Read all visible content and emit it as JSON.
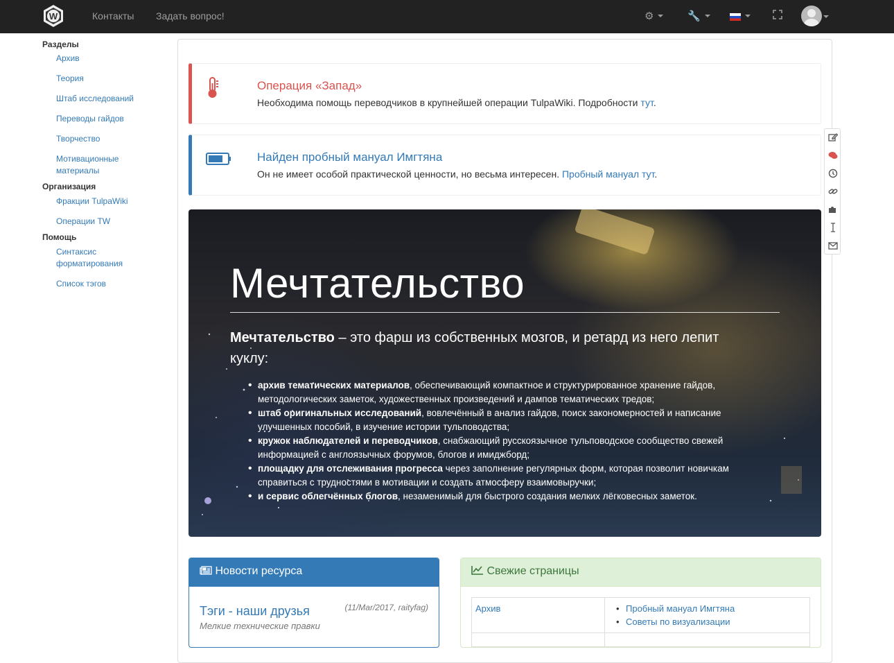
{
  "nav": {
    "links": [
      "Контакты",
      "Задать вопрос!"
    ]
  },
  "sidebar": {
    "sections": [
      {
        "title": "Разделы",
        "items": [
          "Архив",
          "Теория",
          "Штаб исследований",
          "Переводы гайдов",
          "Творчество",
          "Мотивационные материалы"
        ]
      },
      {
        "title": "Организация",
        "items": [
          "Фракции TulpaWiki",
          "Операции TW"
        ]
      },
      {
        "title": "Помощь",
        "items": [
          "Синтаксис форматирования",
          "Список тэгов"
        ]
      }
    ]
  },
  "alerts": [
    {
      "title": "Операция «Запад»",
      "text": "Необходима помощь переводчиков в крупнейшей операции TulpaWiki. Подробности ",
      "link": "тут",
      "tail": ".",
      "color": "#d9534f"
    },
    {
      "title": "Найден пробный мануал Имгтяна",
      "text": "Он не имеет особой практической ценности, но весьма интересен. ",
      "link": "Пробный мануал тут",
      "tail": ".",
      "color": "#337ab7"
    }
  ],
  "hero": {
    "title": "Мечтательство",
    "lead_bold": "Мечтательство",
    "lead_rest": " – это фарш из собственных мозгов, и ретард из него лепит куклу:",
    "items": [
      {
        "bold": "архив тематических материалов",
        "rest": ", обеспечивающий компактное и структурированное хранение гайдов, методологических заметок, художественных произведений и дампов тематических тредов;"
      },
      {
        "bold": "штаб оригинальных исследований",
        "rest": ", вовлечённый в анализ гайдов, поиск закономерностей и написание улучшенных пособий, в изучение истории тульповодства;"
      },
      {
        "bold": "кружок наблюдателей и переводчиков",
        "rest": ", снабжающий русскоязычное тульповодское сообщество свежей информацией с англоязычных форумов, блогов и имиджборд;"
      },
      {
        "bold": "площадку для отслеживания прогресса",
        "rest": " через заполнение регулярных форм, которая позволит новичкам справиться с трудностями в мотивации и создать атмосферу взаимовыручки;"
      },
      {
        "bold": "и сервис облегчённых блогов",
        "rest": ", незаменимый для быстрого создания мелких лёгковесных заметок."
      }
    ]
  },
  "news": {
    "header": "Новости ресурса",
    "item_title": "Тэги - наши друзья",
    "item_meta": "(11/Mar/2017, raityfag)",
    "item_desc": "Мелкие технические правки"
  },
  "fresh": {
    "header": "Свежие страницы",
    "rows": [
      {
        "section": "Архив",
        "pages": [
          "Пробный мануал Имгтяна",
          "Советы по визуализации"
        ]
      }
    ]
  },
  "colors": {
    "navbar": "#222222",
    "link": "#337ab7",
    "danger": "#d9534f",
    "success_bg": "#dff0d8"
  },
  "icons": {
    "toolbar": [
      "edit-icon",
      "comments-icon",
      "history-icon",
      "link-icon",
      "puzzle-icon",
      "cursor-icon",
      "envelope-icon"
    ]
  }
}
